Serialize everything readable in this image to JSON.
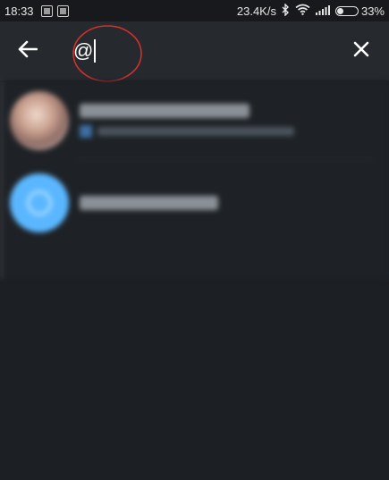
{
  "status_bar": {
    "time": "18:33",
    "network_speed": "23.4K/s",
    "battery_percent": "33%",
    "battery_level": 0.33,
    "icons": [
      "notification-icon",
      "notification-icon-2",
      "bluetooth-icon",
      "wifi-icon",
      "signal-icon",
      "battery-icon"
    ]
  },
  "toolbar": {
    "back_icon": "arrow-left-icon",
    "search_value": "@",
    "close_icon": "close-icon"
  },
  "colors": {
    "background": "#1c1f23",
    "toolbar": "#262a2f",
    "annotation": "#d0312d",
    "saved_avatar": "#5ab7ff"
  }
}
